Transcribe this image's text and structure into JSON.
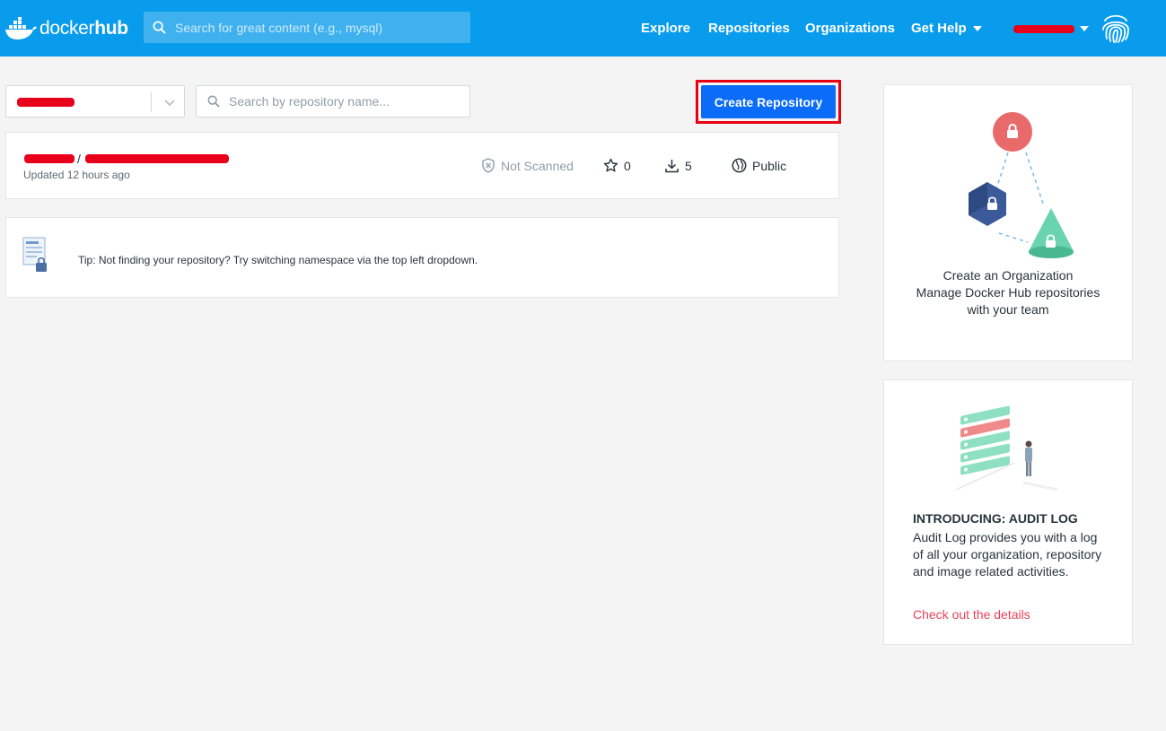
{
  "header": {
    "logo_text_a": "docker",
    "logo_text_b": "hub",
    "search_placeholder": "Search for great content (e.g., mysql)",
    "nav": [
      "Explore",
      "Repositories",
      "Organizations",
      "Get Help"
    ],
    "brand_color": "#099cec"
  },
  "toolbar": {
    "repo_search_placeholder": "Search by repository name...",
    "create_label": "Create Repository",
    "create_color": "#0a6cf9",
    "highlight_color": "#e60012"
  },
  "repo": {
    "separator": "/",
    "updated": "Updated 12 hours ago",
    "scan_status": "Not Scanned",
    "stars": "0",
    "pulls": "5",
    "visibility": "Public"
  },
  "tip": {
    "text": "Tip: Not finding your repository? Try switching namespace via the top left dropdown."
  },
  "org_promo": {
    "line1": "Create an Organization",
    "line2": "Manage Docker Hub repositories",
    "line3": "with your team"
  },
  "audit_promo": {
    "title": "INTRODUCING: AUDIT LOG",
    "body": "Audit Log provides you with a log of all your organization, repository and image related activities.",
    "link": "Check out the details",
    "link_color": "#e8445a"
  },
  "icons": [
    "docker-whale-icon",
    "search-icon",
    "caret-down-icon",
    "fingerprint-icon",
    "chevron-down-icon",
    "shield-x-icon",
    "star-icon",
    "download-icon",
    "globe-icon"
  ]
}
